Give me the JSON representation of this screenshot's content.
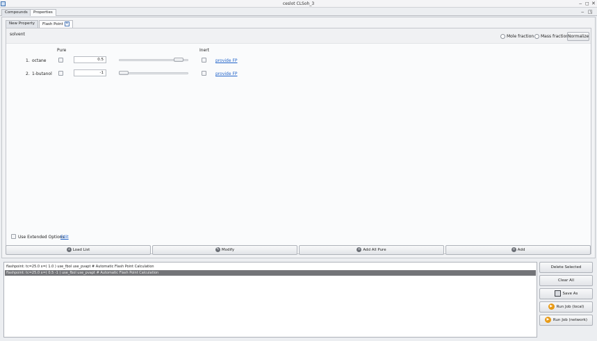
{
  "window": {
    "title": "ceslot CLSoh_3",
    "min_glyph": "‒",
    "restore_glyph": "◻",
    "close_glyph": "✕"
  },
  "top_tabs": [
    "Compounds",
    "Properties"
  ],
  "panel_controls": {
    "min_glyph": "‒",
    "restore_glyph": "◳"
  },
  "sub_tabs": {
    "new": "New Property",
    "flash": "Flash Point",
    "close_glyph": "✕"
  },
  "header": {
    "solvent_label": "solvent",
    "mole_fraction_label": "Mole fraction",
    "mass_fraction_label": "Mass fraction",
    "normalize_label": "Normalize"
  },
  "columns": {
    "pure": "Pure",
    "inert": "Inert"
  },
  "rows": [
    {
      "index": "1.",
      "name": "octane",
      "value": "0.5",
      "link": "provide FP",
      "slider_fraction": 0.92
    },
    {
      "index": "2.",
      "name": "1-butanol",
      "value": "-1",
      "link": "provide FP",
      "slider_fraction": 0.0
    }
  ],
  "extended": {
    "label": "Use Extended Options",
    "edit": "Edit"
  },
  "actions": [
    {
      "label": "Load List",
      "icon": "load-icon"
    },
    {
      "label": "Modify",
      "icon": "modify-icon"
    },
    {
      "label": "Add All Pure",
      "icon": "add-all-icon"
    },
    {
      "label": "Add",
      "icon": "add-icon"
    }
  ],
  "log": [
    "flashpoint: tc=25.0  x=( 1.0 ) use_fbol use_pvapt # Automatic Flash Point Calculation",
    "flashpoint: tc=25.0  x=( 0.5 -1 ) use_fbol use_pvapt # Automatic Flash Point Calculation"
  ],
  "side_buttons": {
    "delete": "Delete Selected",
    "clear": "Clear All",
    "save": "Save As",
    "run_local": "Run Job (local)",
    "run_network": "Run Job (network)"
  }
}
